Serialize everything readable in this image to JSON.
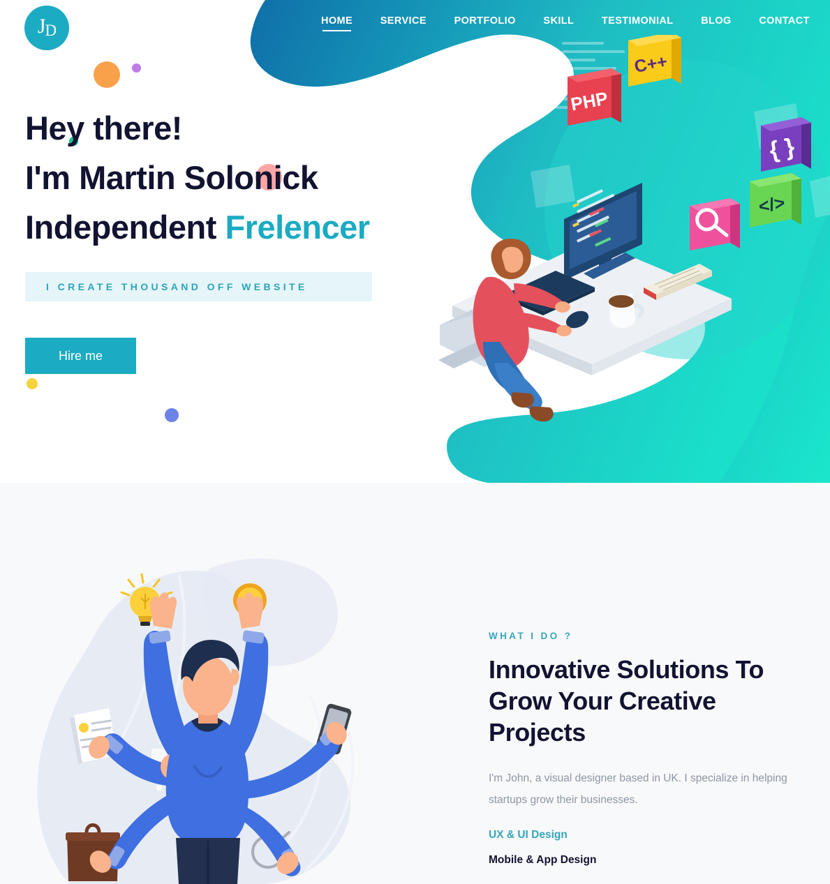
{
  "brand": {
    "logo_initials_first": "J",
    "logo_initials_second": "D",
    "accent_color": "#1BABC2",
    "dark_color": "#121331"
  },
  "nav": {
    "items": [
      {
        "label": "HOME",
        "active": true
      },
      {
        "label": "SERVICE",
        "active": false
      },
      {
        "label": "PORTFOLIO",
        "active": false
      },
      {
        "label": "SKILL",
        "active": false
      },
      {
        "label": "TESTIMONIAL",
        "active": false
      },
      {
        "label": "BLOG",
        "active": false
      },
      {
        "label": "CONTACT",
        "active": false
      }
    ]
  },
  "hero": {
    "line1": "Hey there!",
    "line2": "I'm Martin Solonick",
    "line3_plain": "Independent ",
    "line3_accent": "Frelencer",
    "tagline": "I CREATE THOUSAND OFF WEBSITE",
    "cta_label": "Hire me",
    "illustration": {
      "name": "developer-at-desk-illustration",
      "cube_labels": [
        "PHP",
        "C++",
        "search",
        "braces",
        "code-tag"
      ]
    }
  },
  "about": {
    "eyebrow": "WHAT I DO ?",
    "title": "Innovative Solutions To Grow Your Creative Projects",
    "paragraph": "I'm John, a visual designer based in UK. I specialize in helping startups grow their businesses.",
    "skills": [
      {
        "label": "UX & UI Design",
        "active": true
      },
      {
        "label": "Mobile & App Design",
        "active": false
      }
    ],
    "illustration": {
      "name": "multitasking-person-illustration"
    }
  }
}
